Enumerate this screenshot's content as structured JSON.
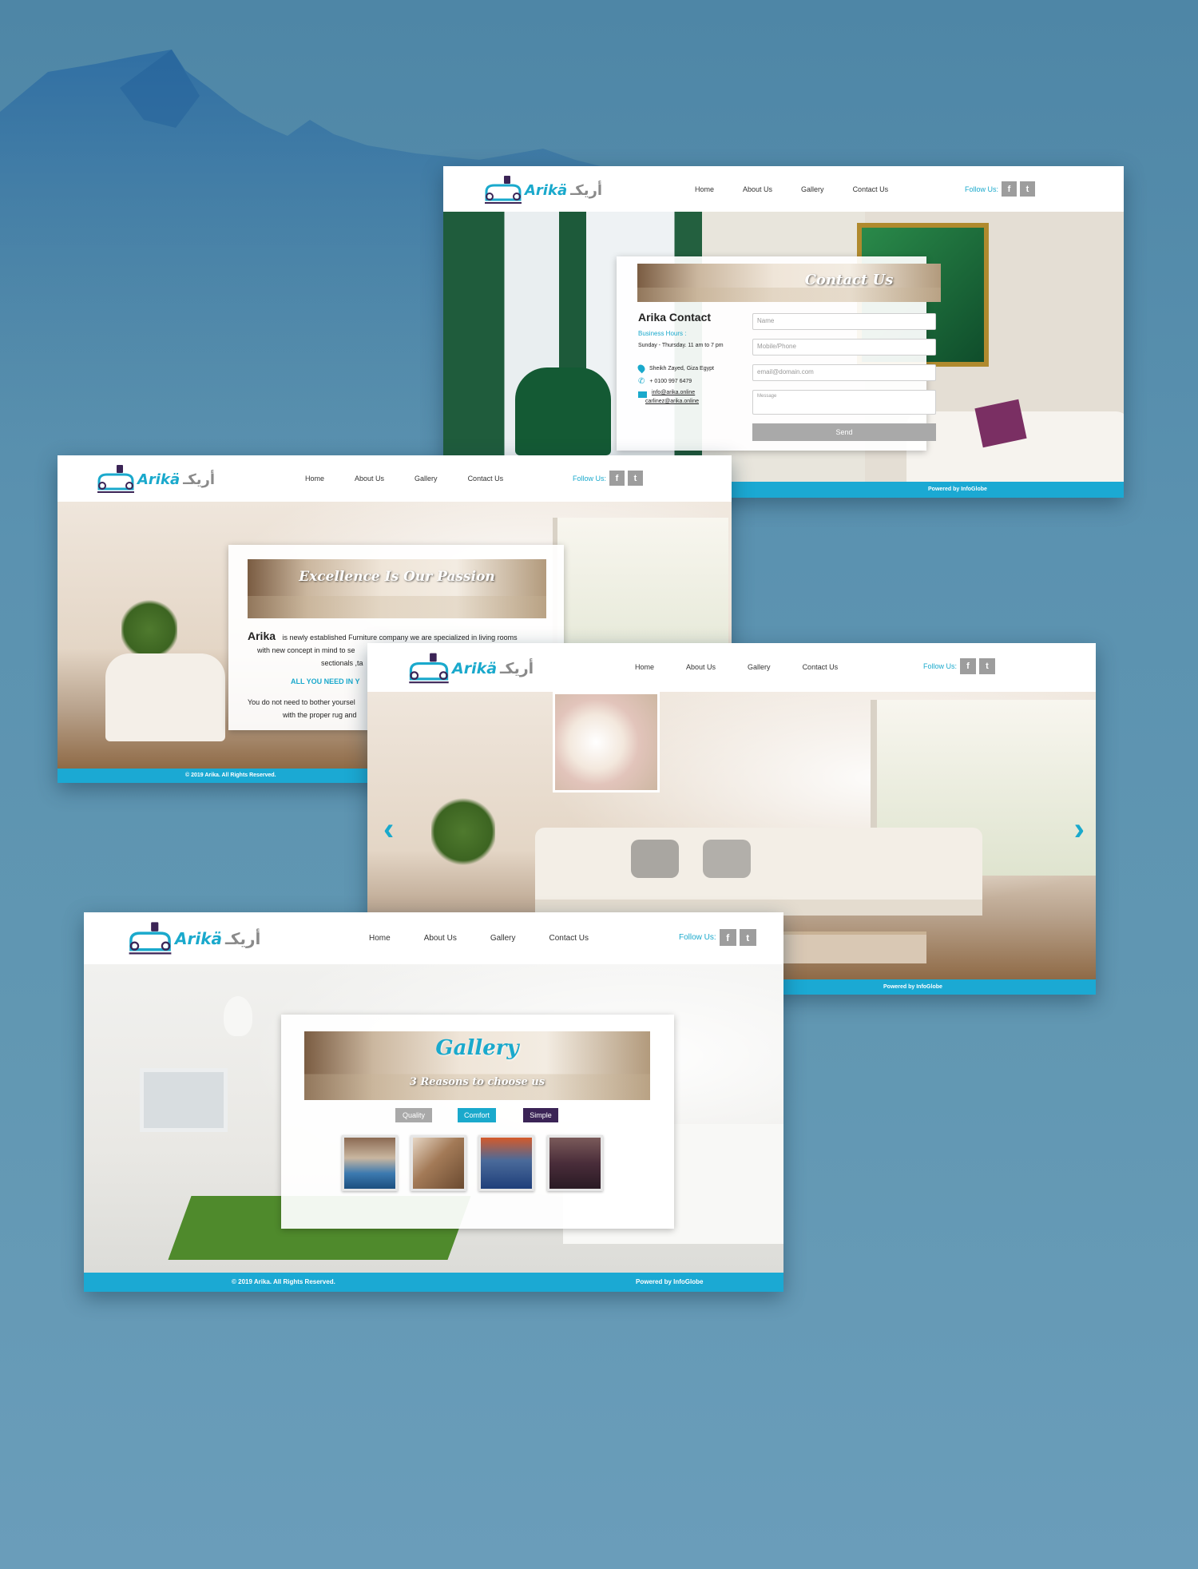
{
  "nav": {
    "home": "Home",
    "about": "About Us",
    "gallery": "Gallery",
    "contact": "Contact Us"
  },
  "follow_label": "Follow Us:",
  "social": {
    "facebook": "f",
    "twitter": "t"
  },
  "logo": {
    "latin": "Arikä",
    "arabic": "أريكـ"
  },
  "contact_page": {
    "banner_title": "Contact Us",
    "heading": "Arika Contact",
    "business_hours_label": "Business Hours :",
    "hours": "Sunday - Thursday. 11 am to 7 pm",
    "address": "Sheikh Zayed, Giza Egypt",
    "phone": "+ 0100 997 6479",
    "email_1": "info@arika.online",
    "email_2": "carlinez@arika.online",
    "fields": {
      "name": "Name",
      "phone": "Mobile/Phone",
      "email": "email@domain.com",
      "message": "Message"
    },
    "send": "Send",
    "footer_right": "Powered by InfoGlobe"
  },
  "about_page": {
    "banner_title": "Excellence Is Our Passion",
    "brand": "Arika",
    "line_1": "is newly established Furniture company we are specialized in living rooms",
    "line_2": "with new concept in mind to se",
    "line_3": "sectionals ,ta",
    "highlight": "ALL YOU NEED IN Y",
    "line_4": "You do not need to bother yoursel",
    "line_5": "with the proper rug and",
    "footer_left": "© 2019 Arika. All Rights Reserved."
  },
  "home_page": {
    "prev": "‹",
    "next": "›",
    "footer_right": "Powered by InfoGlobe"
  },
  "gallery_page": {
    "banner_title": "Gallery",
    "banner_sub": "3 Reasons to choose us",
    "tags": {
      "quality": "Quality",
      "comfort": "Comfort",
      "simple": "Simple"
    },
    "footer_left": "© 2019 Arika. All Rights Reserved.",
    "footer_right": "Powered by InfoGlobe"
  },
  "colors": {
    "accent": "#1ba9d3",
    "social": "#9d9d9d",
    "simple": "#3b2456",
    "quality": "#a9a9a9"
  },
  "icons": [
    "facebook-icon",
    "twitter-icon",
    "location-icon",
    "phone-icon",
    "mail-icon",
    "chevron-left-icon",
    "chevron-right-icon",
    "sofa-logo-icon"
  ]
}
